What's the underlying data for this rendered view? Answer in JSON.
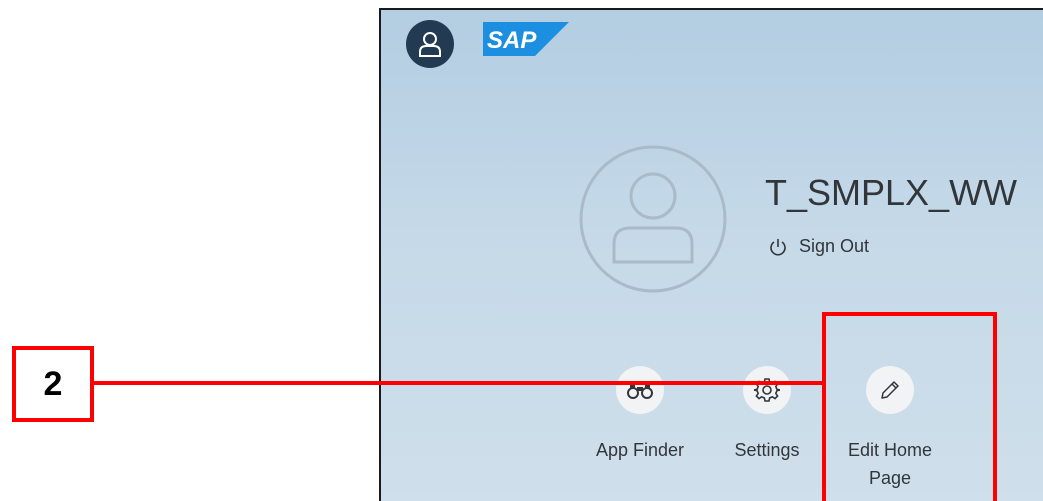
{
  "header": {
    "logo_text": "SAP"
  },
  "user": {
    "name": "T_SMPLX_WW",
    "sign_out_label": "Sign Out"
  },
  "actions": [
    {
      "label": "App Finder",
      "icon": "binoculars-icon"
    },
    {
      "label": "Settings",
      "icon": "gear-icon"
    },
    {
      "label": "Edit Home Page",
      "icon": "pencil-icon"
    }
  ],
  "annotation": {
    "step_number": "2",
    "color": "#ff0000"
  },
  "colors": {
    "avatar_dark": "#223a52",
    "sap_blue": "#1c8fe0",
    "panel_top": "#b3cde2",
    "panel_bottom": "#cfdfeb",
    "text": "#32363a"
  }
}
